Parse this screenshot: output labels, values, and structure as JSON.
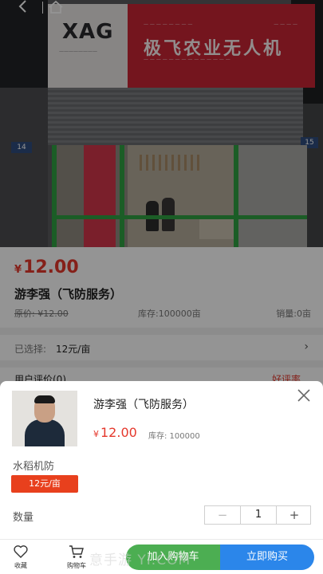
{
  "nav": {
    "back_icon": "chevron-left-icon",
    "home_icon": "home-icon"
  },
  "store_photo": {
    "logo": "XAG",
    "sign_title": "极飞农业无人机",
    "house_number_left": "14",
    "house_number_right": "15"
  },
  "product": {
    "currency": "¥",
    "price": "12.00",
    "title": "游李强（飞防服务）",
    "original_price": "原价: ¥12.00",
    "stock": "库存:100000亩",
    "sales": "销量:0亩"
  },
  "selection": {
    "label": "已选择:",
    "value": "12元/亩",
    "arrow": "›"
  },
  "reviews": {
    "label": "用户评价(0)",
    "right_text": "好评率"
  },
  "sheet": {
    "title": "游李强（飞防服务）",
    "currency": "¥",
    "price": "12.00",
    "stock": "库存: 100000",
    "spec_title": "水稻机防",
    "spec_option": "12元/亩",
    "qty_label": "数量",
    "qty_minus": "−",
    "qty_value": "1",
    "qty_plus": "+"
  },
  "bottom_bar": {
    "favorite_label": "收藏",
    "cart_label": "购物车",
    "add_to_cart": "加入购物车",
    "buy_now": "立即购买"
  },
  "watermark": "意手游 YI.COM",
  "colors": {
    "price_red": "#e5382c",
    "spec_tag": "#e8401d",
    "add_cart_green": "#4cae52",
    "buy_blue": "#2b86ea"
  }
}
